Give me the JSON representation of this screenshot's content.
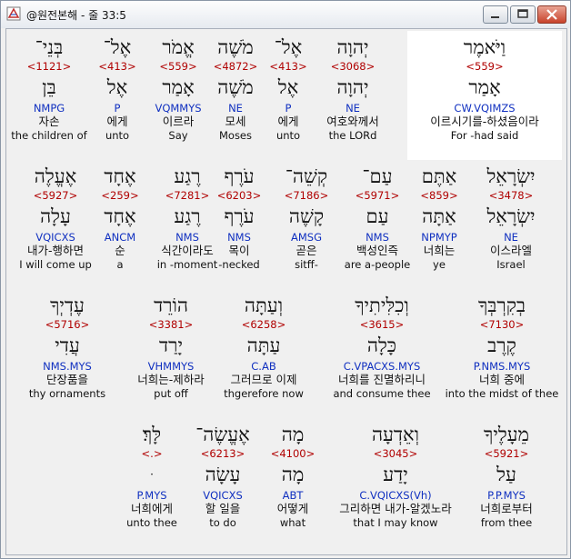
{
  "window": {
    "title": "@원전본해 - 줄 33:5"
  },
  "rows": [
    [
      {
        "heb": "וַיֹּאמֶר",
        "strong": "<559>",
        "lemma": "אָמַר",
        "parse": "CW.VQIMZS",
        "korean": "이르시기를-하셨음이라",
        "english": "For -had said",
        "selected": true
      },
      {
        "heb": "יְהוָה",
        "strong": "<3068>",
        "lemma": "יְהוָה",
        "parse": "NE",
        "korean": "여호와께서",
        "english": "the LORd"
      },
      {
        "heb": "אֶל־",
        "strong": "<413>",
        "lemma": "אֶל",
        "parse": "P",
        "korean": "에게",
        "english": "unto"
      },
      {
        "heb": "מֹשֶׁה",
        "strong": "<4872>",
        "lemma": "מֹשֶׁה",
        "parse": "NE",
        "korean": "모세",
        "english": "Moses"
      },
      {
        "heb": "אֱמֹר",
        "strong": "<559>",
        "lemma": "אָמַר",
        "parse": "VQMMYS",
        "korean": "이르라",
        "english": "Say"
      },
      {
        "heb": "אֶל־",
        "strong": "<413>",
        "lemma": "אֶל",
        "parse": "P",
        "korean": "에게",
        "english": "unto"
      },
      {
        "heb": "בְּנֵי־",
        "strong": "<1121>",
        "lemma": "בֵּן",
        "parse": "NMPG",
        "korean": "자손",
        "english": "the children of"
      }
    ],
    [
      {
        "heb": "יִשְׂרָאֵל",
        "strong": "<3478>",
        "lemma": "יִשְׂרָאֵל",
        "parse": "NE",
        "korean": "이스라엘",
        "english": "Israel"
      },
      {
        "heb": "אַתֶּם",
        "strong": "<859>",
        "lemma": "אַתָּה",
        "parse": "NPMYP",
        "korean": "너희는",
        "english": "ye"
      },
      {
        "heb": "עַם־",
        "strong": "<5971>",
        "lemma": "עַם",
        "parse": "NMS",
        "korean": "백성인즉",
        "english": "are a-people"
      },
      {
        "heb": "קְשֵׁה־",
        "strong": "<7186>",
        "lemma": "קָשֶׁה",
        "parse": "AMSG",
        "korean": "곧은",
        "english": "sitff-"
      },
      {
        "heb": "עֹרֶף",
        "strong": "<6203>",
        "lemma": "עֹרֶף",
        "parse": "NMS",
        "korean": "목이",
        "english": "-necked"
      },
      {
        "heb": "רֶגַע",
        "strong": "<7281>",
        "lemma": "רֶגַע",
        "parse": "NMS",
        "korean": "식간이라도",
        "english": "in -moment"
      },
      {
        "heb": "אֶחָד",
        "strong": "<259>",
        "lemma": "אֶחָד",
        "parse": "ANCM",
        "korean": "순",
        "english": "a"
      },
      {
        "heb": "אֶעֱלֶה",
        "strong": "<5927>",
        "lemma": "עָלָה",
        "parse": "VQICXS",
        "korean": "내가-행하면",
        "english": "I will come up"
      }
    ],
    [
      {
        "heb": "בְקִרְבְּךָ",
        "strong": "<7130>",
        "lemma": "קֶרֶב",
        "parse": "P.NMS.MYS",
        "korean": "너희 중에",
        "english": "into the midst of thee"
      },
      {
        "heb": "וְכִלִּיתִיךָ",
        "strong": "<3615>",
        "lemma": "כָּלָה",
        "parse": "C.VPACXS.MYS",
        "korean": "너희를 진멸하리니",
        "english": "and consume thee"
      },
      {
        "heb": "וְעַתָּה",
        "strong": "<6258>",
        "lemma": "עַתָּה",
        "parse": "C.AB",
        "korean": "그러므로 이제",
        "english": "thgerefore now"
      },
      {
        "heb": "הוֹרֵד",
        "strong": "<3381>",
        "lemma": "יָרַד",
        "parse": "VHMMYS",
        "korean": "너희는-제하라",
        "english": "put off"
      },
      {
        "heb": "עֶדְיְךָ",
        "strong": "<5716>",
        "lemma": "עֲדִי",
        "parse": "NMS.MYS",
        "korean": "단장품을",
        "english": "thy ornaments"
      }
    ],
    [
      {
        "heb": "מֵעָלֶיךָ",
        "strong": "<5921>",
        "lemma": "עַל",
        "parse": "P.P.MYS",
        "korean": "너희로부터",
        "english": "from thee"
      },
      {
        "heb": "וְאֵדְעָה",
        "strong": "<3045>",
        "lemma": "יָדַע",
        "parse": "C.VQICXS(Vh)",
        "korean": "그리하면 내가-알겠노라",
        "english": "that I may know"
      },
      {
        "heb": "מָה",
        "strong": "<4100>",
        "lemma": "מָה",
        "parse": "ABT",
        "korean": "어떻게",
        "english": "what"
      },
      {
        "heb": "אֶעֱשֶׂה־",
        "strong": "<6213>",
        "lemma": "עָשָׂה",
        "parse": "VQICXS",
        "korean": "할 일을",
        "english": "to do"
      },
      {
        "heb": "לָּךְ׃",
        "strong": "<.>",
        "lemma": "ּ",
        "parse": "P.MYS",
        "korean": "너희에게",
        "english": "unto thee"
      }
    ]
  ]
}
